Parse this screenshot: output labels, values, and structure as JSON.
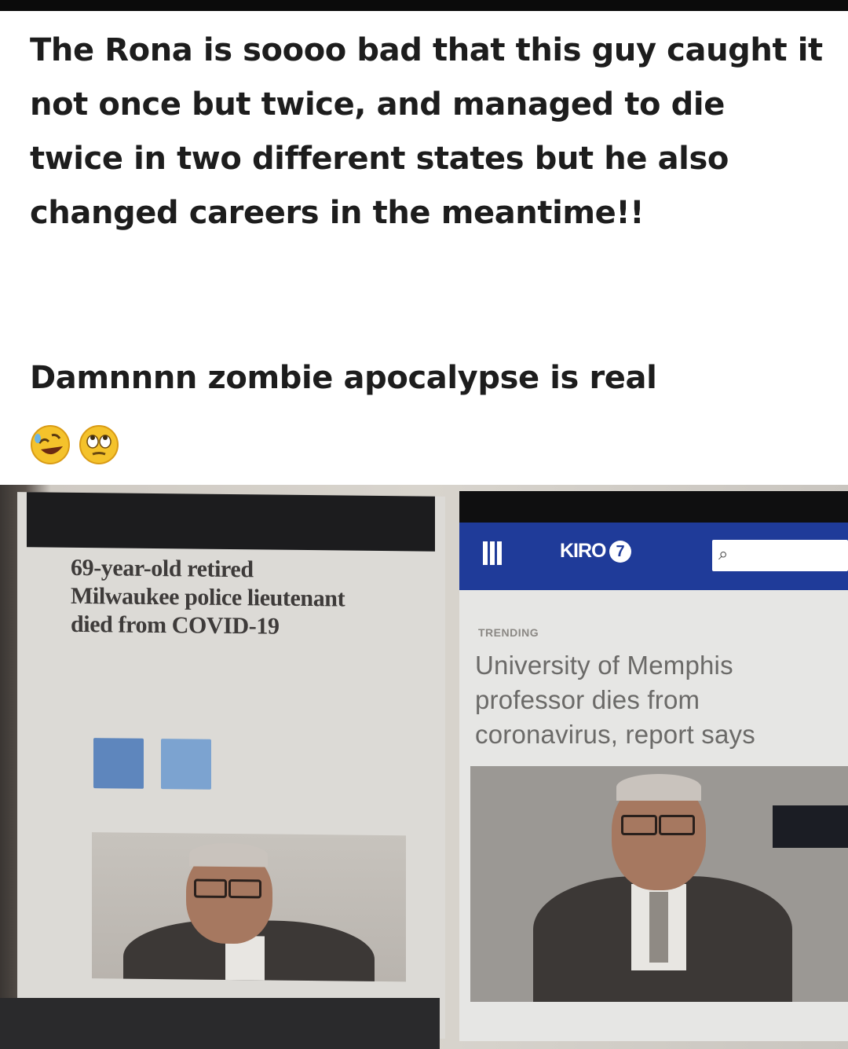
{
  "post": {
    "caption": "The Rona is soooo bad that this guy caught it not once but twice, and managed to die twice in two different states but he also changed careers in the meantime!!",
    "punchline": "Damnnnn zombie apocalypse is real",
    "emojis": [
      "rolling-on-floor-laughing-emoji",
      "face-with-rolling-eyes-emoji"
    ]
  },
  "left_article": {
    "headline": "69-year-old retired Milwaukee police lieutenant died from COVID-19"
  },
  "right_article": {
    "logo": "KIRO",
    "logo_number": "7",
    "label": "TRENDING",
    "headline": "University of Memphis professor dies from coronavirus, report says"
  },
  "colors": {
    "kiro_blue": "#1f3b99",
    "facebook_blue": "#5e86bd",
    "twitter_blue": "#7ca3d0"
  }
}
